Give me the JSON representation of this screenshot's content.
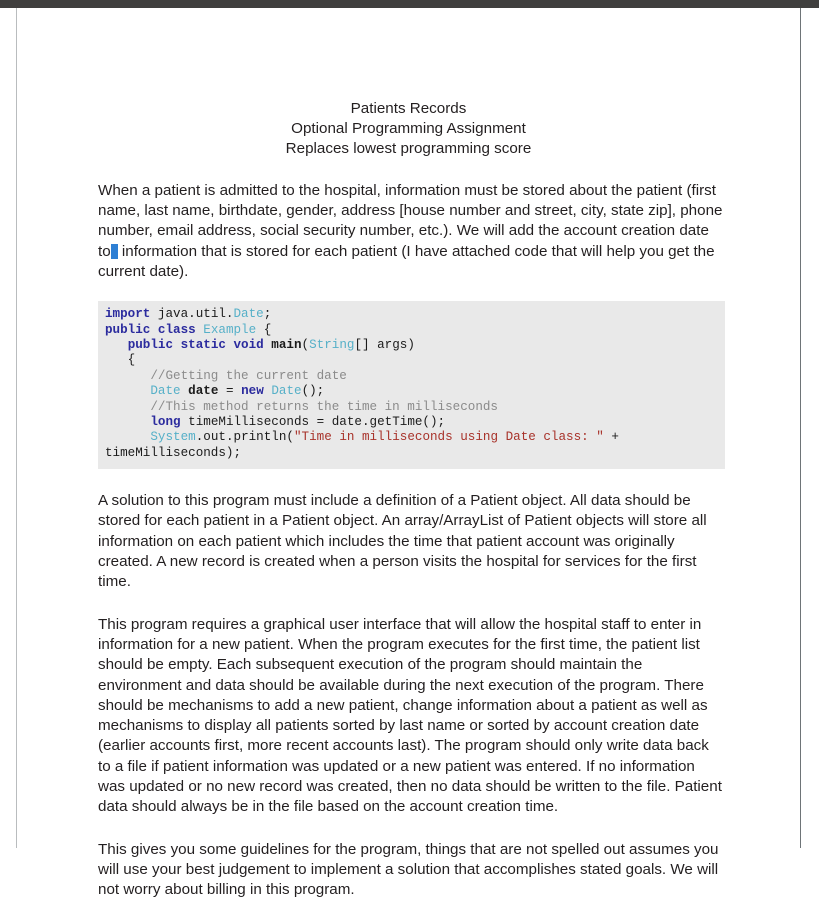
{
  "document": {
    "heading": {
      "lines": [
        "Patients Records",
        "Optional Programming Assignment",
        "Replaces lowest programming score"
      ]
    },
    "paragraphs": {
      "p1_before_caret": "When a patient is admitted to the hospital, information must be stored about the patient (first name, last name, birthdate, gender, address [house number and street, city, state zip], phone number, email address, social security number, etc.).   We will add the account creation date to",
      "p1_after_caret": " information that is stored for each patient (I have attached code that will help you get the current date).",
      "p2": "A solution to this program must include a definition of a Patient object.  All data should be stored for each patient in a Patient object.  An array/ArrayList of Patient objects will store all information on each patient which includes the time that patient account was originally created.  A new record is created when a person visits the hospital for services for the first time.",
      "p3": "This program requires a graphical user interface that will allow the hospital staff to enter in information for a new patient.  When the program executes for the first time, the patient list should be empty. Each subsequent execution of the program should maintain the environment and data should be available during the next execution of the program.  There should be mechanisms to add a new patient, change information about a patient as well as mechanisms to display all patients sorted by last name or sorted by account creation date (earlier accounts first, more recent accounts last).  The program should only write data back to a file if patient information was updated or a new patient was entered.  If no information was updated or no new record was created, then no data should be written to the file.  Patient data should always be in the file based on the account creation time.",
      "p4": "This gives you some guidelines for the program, things that are not spelled out assumes you will use your best judgement to implement a solution that accomplishes stated goals.  We will not worry about billing in this program."
    },
    "code_listing": {
      "language": "java",
      "lines": [
        {
          "id": "line-import",
          "tokens": [
            {
              "text": "import",
              "kind": "key"
            },
            {
              "text": " java.util.",
              "kind": "plain"
            },
            {
              "text": "Date",
              "kind": "type"
            },
            {
              "text": ";",
              "kind": "plain"
            }
          ]
        },
        {
          "id": "line-class-decl",
          "tokens": [
            {
              "text": "public class",
              "kind": "key"
            },
            {
              "text": " ",
              "kind": "plain"
            },
            {
              "text": "Example",
              "kind": "type"
            },
            {
              "text": " {",
              "kind": "plain"
            }
          ]
        },
        {
          "id": "line-main-decl",
          "tokens": [
            {
              "text": "   ",
              "kind": "plain"
            },
            {
              "text": "public static void",
              "kind": "key"
            },
            {
              "text": " ",
              "kind": "plain"
            },
            {
              "text": "main",
              "kind": "bold"
            },
            {
              "text": "(",
              "kind": "plain"
            },
            {
              "text": "String",
              "kind": "type"
            },
            {
              "text": "[] args)",
              "kind": "plain"
            }
          ]
        },
        {
          "id": "line-open-brace",
          "tokens": [
            {
              "text": "   {",
              "kind": "plain"
            }
          ]
        },
        {
          "id": "line-comment-1",
          "tokens": [
            {
              "text": "      //Getting the current date",
              "kind": "cmt"
            }
          ]
        },
        {
          "id": "line-date-init",
          "tokens": [
            {
              "text": "      ",
              "kind": "plain"
            },
            {
              "text": "Date",
              "kind": "type"
            },
            {
              "text": " ",
              "kind": "plain"
            },
            {
              "text": "date",
              "kind": "bold"
            },
            {
              "text": " = ",
              "kind": "plain"
            },
            {
              "text": "new",
              "kind": "key"
            },
            {
              "text": " ",
              "kind": "plain"
            },
            {
              "text": "Date",
              "kind": "type"
            },
            {
              "text": "();",
              "kind": "plain"
            }
          ]
        },
        {
          "id": "line-comment-2",
          "tokens": [
            {
              "text": "      //This method returns the time in milliseconds",
              "kind": "cmt"
            }
          ]
        },
        {
          "id": "line-long-decl",
          "tokens": [
            {
              "text": "      ",
              "kind": "plain"
            },
            {
              "text": "long",
              "kind": "key"
            },
            {
              "text": " timeMilliseconds = date.getTime();",
              "kind": "plain"
            }
          ]
        },
        {
          "id": "line-println",
          "tokens": [
            {
              "text": "      ",
              "kind": "plain"
            },
            {
              "text": "System",
              "kind": "type"
            },
            {
              "text": ".out.println(",
              "kind": "plain"
            },
            {
              "text": "\"Time in milliseconds using Date class: \"",
              "kind": "str"
            },
            {
              "text": " +",
              "kind": "plain"
            }
          ]
        },
        {
          "id": "line-println-cont",
          "tokens": [
            {
              "text": "timeMilliseconds);",
              "kind": "plain"
            }
          ]
        }
      ]
    },
    "colors": {
      "page_background": "#ffffff",
      "body_text": "#231f20",
      "chrome_bar": "#403f3e",
      "code_background": "#e9e9e9",
      "code_keyword": "#2b2b9e",
      "code_type": "#56b0c8",
      "code_comment": "#8b8b8b",
      "code_string": "#a8322a",
      "code_plain": "#1b1b1b",
      "text_caret": "#2e7fd4"
    }
  }
}
